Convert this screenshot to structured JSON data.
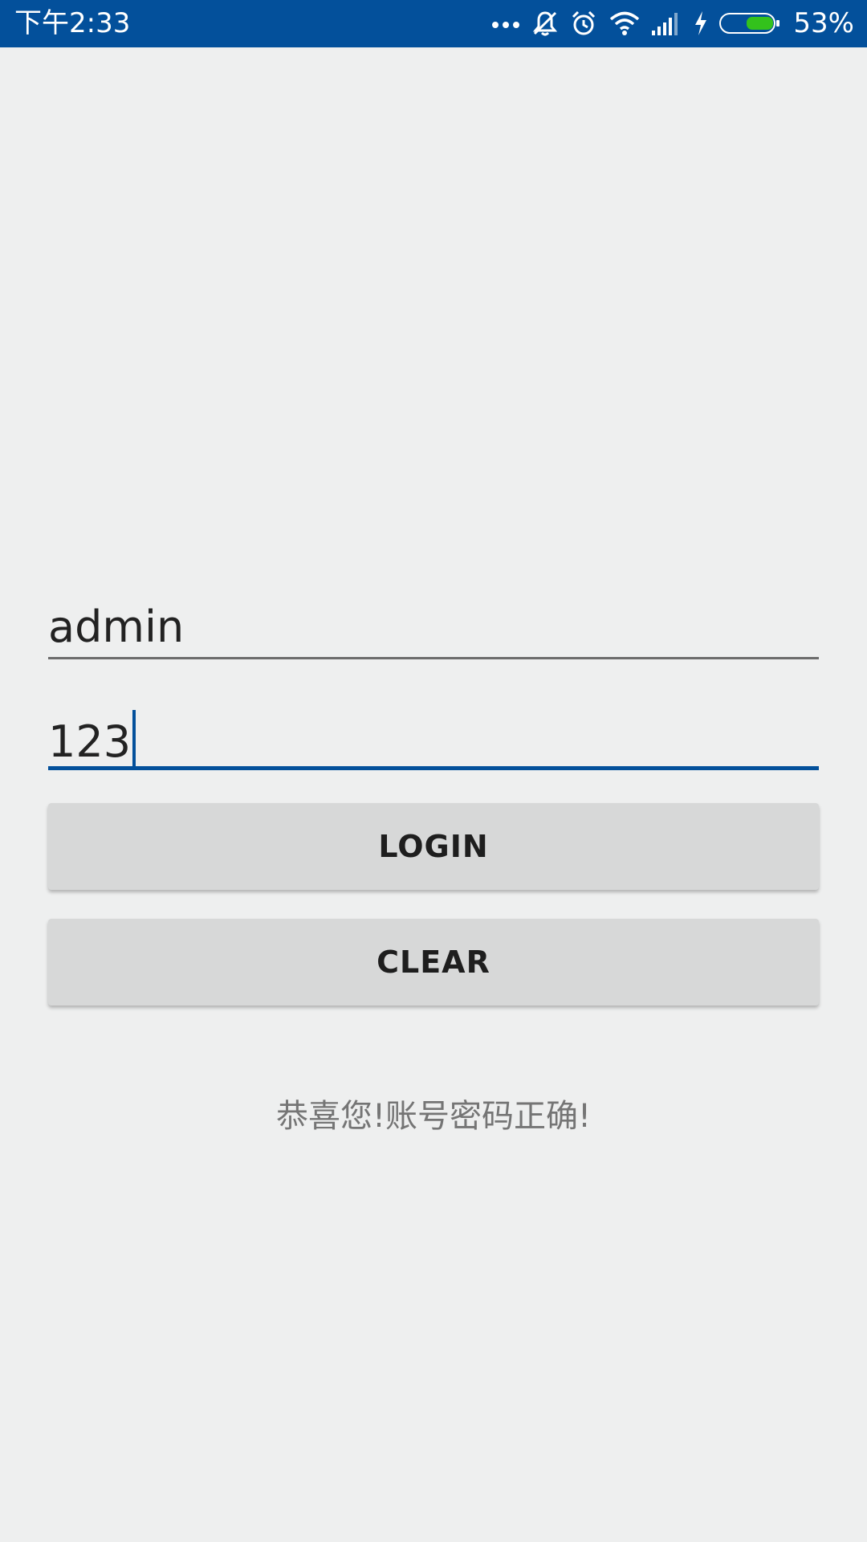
{
  "status_bar": {
    "time": "下午2:33",
    "battery_percent": "53%",
    "battery_level": 0.53,
    "icons": [
      "more-dots-icon",
      "vibrate-off-icon",
      "alarm-icon",
      "wifi-icon",
      "signal-icon",
      "charging-icon",
      "battery-icon"
    ],
    "background_color": "#03509b",
    "battery_color": "#33c21c"
  },
  "form": {
    "username_value": "admin",
    "password_value": "123",
    "login_label": "LOGIN",
    "clear_label": "CLEAR",
    "accent_color": "#03509b"
  },
  "result": {
    "message": "恭喜您!账号密码正确!"
  }
}
